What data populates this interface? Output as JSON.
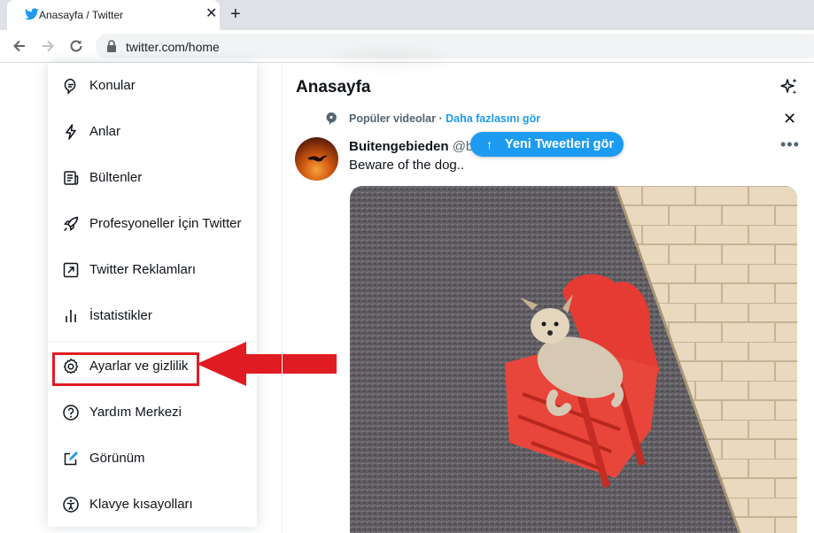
{
  "browser": {
    "tab_title": "Anasayfa / Twitter",
    "tab_close": "✕",
    "new_tab": "+",
    "url": "twitter.com/home"
  },
  "menu": {
    "items": [
      {
        "label": "Konular",
        "icon": "topics-icon"
      },
      {
        "label": "Anlar",
        "icon": "lightning-icon"
      },
      {
        "label": "Bültenler",
        "icon": "newsletter-icon"
      },
      {
        "label": "Profesyoneller İçin Twitter",
        "icon": "rocket-icon"
      },
      {
        "label": "Twitter Reklamları",
        "icon": "external-arrow-icon"
      },
      {
        "label": "İstatistikler",
        "icon": "analytics-icon"
      },
      {
        "label": "Ayarlar ve gizlilik",
        "icon": "gear-icon"
      },
      {
        "label": "Yardım Merkezi",
        "icon": "help-icon"
      },
      {
        "label": "Görünüm",
        "icon": "display-icon"
      },
      {
        "label": "Klavye kısayolları",
        "icon": "accessibility-icon"
      }
    ],
    "highlighted_item": "Ayarlar ve gizlilik",
    "highlight_color": "#e11b22"
  },
  "main": {
    "title": "Anasayfa",
    "context_label": "Popüler videolar",
    "context_separator": "·",
    "context_link": "Daha fazlasını gör",
    "new_tweets_button": "Yeni Tweetleri gör",
    "tweet": {
      "author": "Buitengebieden",
      "handle": "@b",
      "text": "Beware of the dog.."
    }
  },
  "colors": {
    "accent": "#1d9bf0",
    "annotation_red": "#e11b22"
  }
}
